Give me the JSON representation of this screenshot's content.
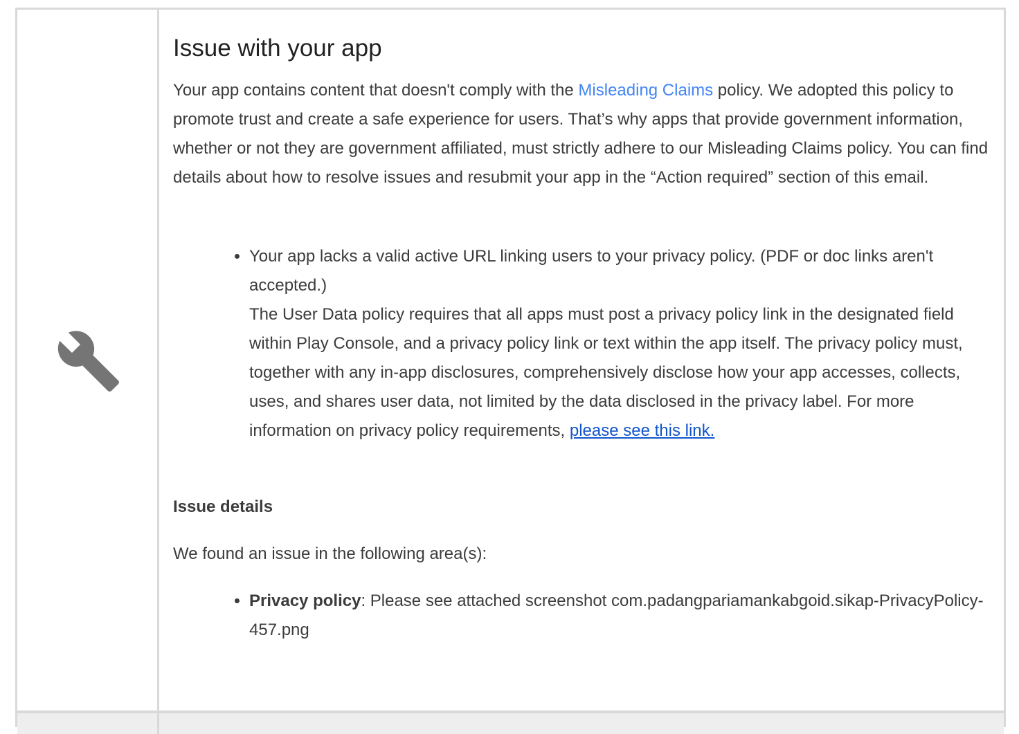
{
  "title": "Issue with your app",
  "intro": {
    "before_link": "Your app contains content that doesn't comply with the ",
    "link": "Misleading Claims",
    "after_link": " policy. We adopted this policy to promote trust and create a safe experience for users. That’s why apps that provide government information, whether or not they are government affiliated, must strictly adhere to our Misleading Claims policy. You can find details about how to resolve issues and resubmit your app in the “Action required” section of this email."
  },
  "issue_item": {
    "headline": "Your app lacks a valid active URL linking users to your privacy policy. (PDF or doc links aren't accepted.)",
    "body": "The User Data policy requires that all apps must post a privacy policy link in the designated field within Play Console, and a privacy policy link or text within the app itself. The privacy policy must, together with any in-app disclosures, comprehensively disclose how your app accesses, collects, uses, and shares user data, not limited by the data disclosed in the privacy label. For more information on privacy policy requirements, ",
    "link": "please see this link."
  },
  "details": {
    "heading": "Issue details",
    "found": "We found an issue in the following area(s):",
    "area_label": "Privacy policy",
    "area_text": ": Please see attached screenshot com.padangpariamankabgoid.sikap-PrivacyPolicy-457.png"
  },
  "colors": {
    "link": "#4285f4",
    "underlined_link": "#1155cc",
    "border": "#d9d9d9",
    "icon": "#757575"
  }
}
